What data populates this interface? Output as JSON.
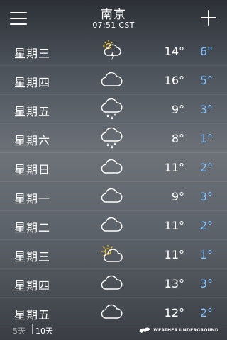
{
  "header": {
    "city": "南京",
    "time": "07:51 CST"
  },
  "forecast": [
    {
      "day": "星期三",
      "icon": "sun-cloud-thunder-icon",
      "high": "14°",
      "low": "6°"
    },
    {
      "day": "星期四",
      "icon": "cloud-icon",
      "high": "16°",
      "low": "5°"
    },
    {
      "day": "星期五",
      "icon": "cloud-rain-icon",
      "high": "9°",
      "low": "3°"
    },
    {
      "day": "星期六",
      "icon": "cloud-rain-icon",
      "high": "8°",
      "low": "1°"
    },
    {
      "day": "星期日",
      "icon": "cloud-icon",
      "high": "11°",
      "low": "2°"
    },
    {
      "day": "星期一",
      "icon": "cloud-icon",
      "high": "9°",
      "low": "3°"
    },
    {
      "day": "星期二",
      "icon": "cloud-icon",
      "high": "11°",
      "low": "2°"
    },
    {
      "day": "星期三",
      "icon": "partly-sunny-icon",
      "high": "11°",
      "low": "1°"
    },
    {
      "day": "星期四",
      "icon": "cloud-icon",
      "high": "13°",
      "low": "3°"
    },
    {
      "day": "星期五",
      "icon": "cloud-icon",
      "high": "12°",
      "low": "2°"
    }
  ],
  "footer": {
    "tab_5": "5天",
    "tab_10": "10天",
    "active_tab": "10天",
    "logo_text": "WEATHER UNDERGROUND"
  },
  "colors": {
    "low_temp": "#7fc0ff",
    "sun": "#f5c518"
  }
}
